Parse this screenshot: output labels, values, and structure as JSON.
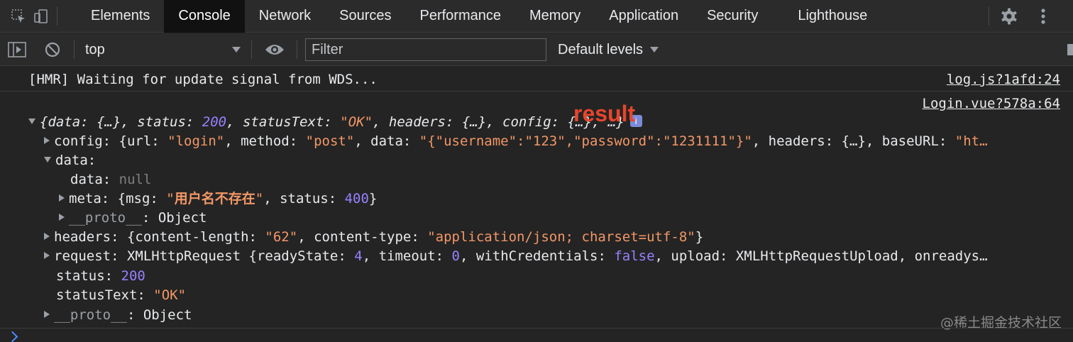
{
  "tabs": [
    "Elements",
    "Console",
    "Network",
    "Sources",
    "Performance",
    "Memory",
    "Application",
    "Security",
    "Lighthouse"
  ],
  "active_tab": "Console",
  "toolbar": {
    "context": "top",
    "filter_placeholder": "Filter",
    "levels": "Default levels"
  },
  "console": {
    "hmr_message": "[HMR] Waiting for update signal from WDS...",
    "hmr_source": "log.js?1afd:24",
    "obj_source": "Login.vue?578a:64",
    "summary": {
      "p1": "{data: {…}, status: ",
      "status": "200",
      "p2": ", statusText: ",
      "statusText": "\"OK\"",
      "p3": ", headers: {…}, config: {…}, …}"
    },
    "config": {
      "key": "config",
      "p1": ": {url: ",
      "url": "\"login\"",
      "p2": ", method: ",
      "method": "\"post\"",
      "p3": ", data: ",
      "data": "\"{\"username\":\"123\",\"password\":\"1231111\"}\"",
      "p4": ", headers: {…}, baseURL: ",
      "baseURL": "\"ht…"
    },
    "data_key": "data:",
    "inner_data_key": "data: ",
    "inner_data_val": "null",
    "meta": {
      "p1": "meta: {msg: ",
      "q1": "\"",
      "msg": "用户名不存在",
      "q2": "\"",
      "p2": ", status: ",
      "status": "400",
      "p3": "}"
    },
    "inner_proto_key": "__proto__",
    "inner_proto_val": ": Object",
    "headers": {
      "p1": "headers: {content-length: ",
      "len": "\"62\"",
      "p2": ", content-type: ",
      "type": "\"application/json; charset=utf-8\"",
      "p3": "}"
    },
    "request": {
      "p1": "request: XMLHttpRequest {readyState: ",
      "rs": "4",
      "p2": ", timeout: ",
      "to": "0",
      "p3": ", withCredentials: ",
      "wc": "false",
      "p4": ", upload: XMLHttpRequestUpload, onreadys…"
    },
    "status_key": "status: ",
    "status_val": "200",
    "statusText_key": "statusText: ",
    "statusText_val": "\"OK\"",
    "proto_key": "__proto__",
    "proto_val": ": Object"
  },
  "annotation": "result",
  "watermark": "@稀土掘金技术社区",
  "colors": {
    "string": "#f29766",
    "number": "#9980ff",
    "annotation": "#e8452c"
  }
}
